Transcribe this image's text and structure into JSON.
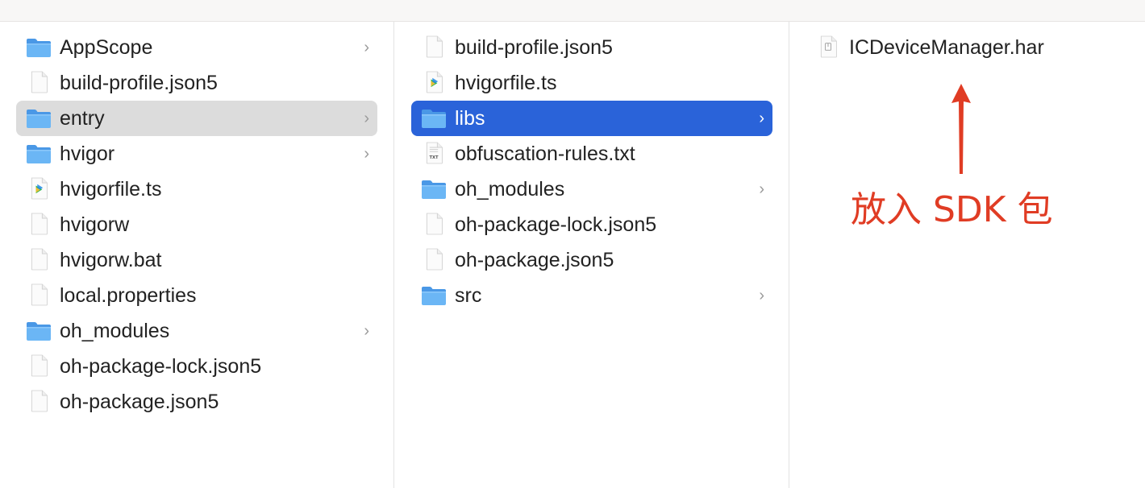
{
  "columns": [
    {
      "items": [
        {
          "name": "AppScope",
          "type": "folder",
          "chevron": true
        },
        {
          "name": "build-profile.json5",
          "type": "file",
          "chevron": false
        },
        {
          "name": "entry",
          "type": "folder",
          "chevron": true,
          "selected": "inactive"
        },
        {
          "name": "hvigor",
          "type": "folder",
          "chevron": true
        },
        {
          "name": "hvigorfile.ts",
          "type": "ts",
          "chevron": false
        },
        {
          "name": "hvigorw",
          "type": "file",
          "chevron": false
        },
        {
          "name": "hvigorw.bat",
          "type": "file",
          "chevron": false
        },
        {
          "name": "local.properties",
          "type": "file",
          "chevron": false
        },
        {
          "name": "oh_modules",
          "type": "folder",
          "chevron": true
        },
        {
          "name": "oh-package-lock.json5",
          "type": "file",
          "chevron": false
        },
        {
          "name": "oh-package.json5",
          "type": "file",
          "chevron": false
        }
      ]
    },
    {
      "items": [
        {
          "name": "build-profile.json5",
          "type": "file",
          "chevron": false
        },
        {
          "name": "hvigorfile.ts",
          "type": "ts",
          "chevron": false
        },
        {
          "name": "libs",
          "type": "folder",
          "chevron": true,
          "selected": "active"
        },
        {
          "name": "obfuscation-rules.txt",
          "type": "txt",
          "chevron": false
        },
        {
          "name": "oh_modules",
          "type": "folder",
          "chevron": true
        },
        {
          "name": "oh-package-lock.json5",
          "type": "file",
          "chevron": false
        },
        {
          "name": "oh-package.json5",
          "type": "file",
          "chevron": false
        },
        {
          "name": "src",
          "type": "folder",
          "chevron": true
        }
      ]
    },
    {
      "items": [
        {
          "name": "ICDeviceManager.har",
          "type": "har",
          "chevron": false
        }
      ]
    }
  ],
  "annotation": {
    "text": "放入 SDK 包",
    "color": "#e03c24"
  },
  "icons": {
    "folder": "folder-icon",
    "file": "file-icon",
    "ts": "ts-file-icon",
    "txt": "txt-file-icon",
    "har": "har-file-icon",
    "chevron": "chevron-right-icon"
  },
  "colors": {
    "selection_active": "#2a63d9",
    "selection_inactive": "#dcdcdc",
    "folder": "#5eaaf0"
  }
}
